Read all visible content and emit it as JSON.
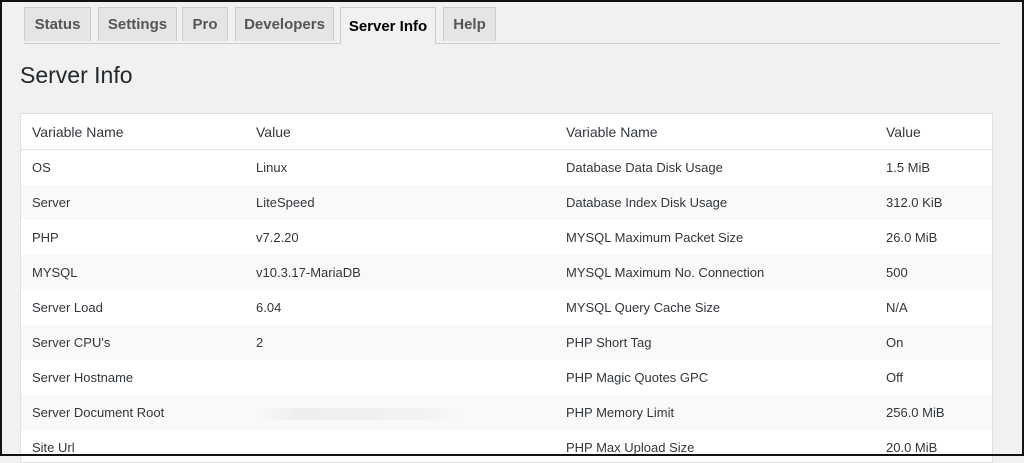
{
  "tabs": [
    {
      "label": "Status"
    },
    {
      "label": "Settings"
    },
    {
      "label": "Pro"
    },
    {
      "label": "Developers"
    },
    {
      "label": "Server Info",
      "active": true
    },
    {
      "label": "Help"
    }
  ],
  "page_title": "Server Info",
  "table": {
    "headers": [
      "Variable Name",
      "Value",
      "Variable Name",
      "Value"
    ],
    "rows": [
      [
        "OS",
        "Linux",
        "Database Data Disk Usage",
        "1.5 MiB"
      ],
      [
        "Server",
        "LiteSpeed",
        "Database Index Disk Usage",
        "312.0 KiB"
      ],
      [
        "PHP",
        "v7.2.20",
        "MYSQL Maximum Packet Size",
        "26.0 MiB"
      ],
      [
        "MYSQL",
        "v10.3.17-MariaDB",
        "MYSQL Maximum No. Connection",
        "500"
      ],
      [
        "Server Load",
        "6.04",
        "MYSQL Query Cache Size",
        "N/A"
      ],
      [
        "Server CPU's",
        "2",
        "PHP Short Tag",
        "On"
      ],
      [
        "Server Hostname",
        "",
        "PHP Magic Quotes GPC",
        "Off"
      ],
      [
        "Server Document Root",
        "",
        "PHP Memory Limit",
        "256.0 MiB"
      ],
      [
        "Site Url",
        "",
        "PHP Max Upload Size",
        "20.0 MiB"
      ]
    ]
  }
}
